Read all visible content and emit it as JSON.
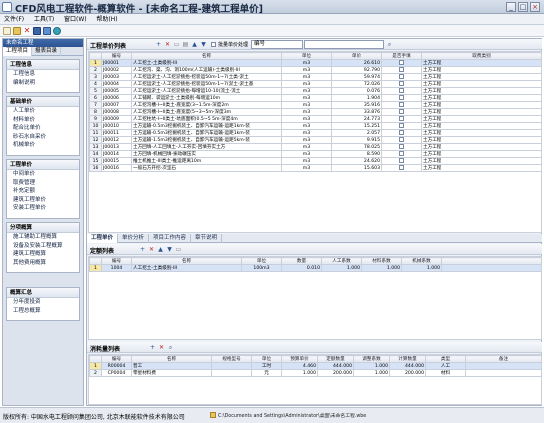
{
  "window": {
    "title": "CFD风电工程软件-概算软件 - [未命名工程-建筑工程单价]",
    "controls": [
      "_",
      "□",
      "×"
    ]
  },
  "menu": {
    "items": [
      "文件(F)",
      "工具(T)",
      "窗口(W)",
      "帮助(H)"
    ]
  },
  "left_panel": {
    "title": "未命名工程",
    "tabs": [
      "工程项目",
      "报表目录"
    ],
    "groups": [
      {
        "title": "工程信息",
        "items": [
          "工程信息",
          "编制说明"
        ]
      },
      {
        "title": "基础单价",
        "items": [
          "人工单价",
          "材料单价",
          "配合比单价",
          "砂石水自采价",
          "机械单价"
        ]
      },
      {
        "title": "工程单价",
        "items": [
          "中间单价",
          "取费管理",
          "补充定额",
          "建筑工程单价",
          "安装工程单价"
        ]
      },
      {
        "title": "分项概算",
        "items": [
          "施工辅助工程概算",
          "设备及安装工程概算",
          "建筑工程概算",
          "其他费用概算"
        ]
      },
      {
        "title": "概算汇总",
        "items": [
          "分年度投资",
          "工程总概算"
        ]
      }
    ]
  },
  "unit_price": {
    "title": "工程单价列表",
    "toolbar_check_label": "批量单价处理",
    "search_placeholder": "编号",
    "columns": [
      "",
      "编号",
      "名称",
      "单位",
      "单价",
      "是否手填",
      "取费类别"
    ],
    "rows": [
      [
        "1",
        "J00001",
        "人工挖土-土类级别-III",
        "m3",
        "26.610",
        "土方工程"
      ],
      [
        "2",
        "J00002",
        "人工挖沟、渠、沟、洞100m(人工运输)-土类级别-III",
        "m3",
        "92.790",
        "土方工程"
      ],
      [
        "3",
        "J00003",
        "人工挖运淤土-人工挖淤挑抬-挖装运50m-1~7(土类-淤土",
        "m3",
        "59.974",
        "土方工程"
      ],
      [
        "4",
        "J00004",
        "人工挖运淤土-人工挖淤挑抬-挖装运50m-1~7(淤土-淤土基",
        "m3",
        "72.026",
        "土方工程"
      ],
      [
        "5",
        "J00005",
        "人工挖运淤土-人工挖淤挑抬-每增运10-10(流土-流土",
        "m3",
        "0.076",
        "土方工程"
      ],
      [
        "6",
        "J00006",
        "人工铺砌、袋运淤土-土类级别-每增运10m",
        "m3",
        "1.904",
        "土方工程"
      ],
      [
        "7",
        "J00007",
        "人工挖沟槽-I~II类土-底宽度(3~1.5m-深度2m",
        "m3",
        "35.916",
        "土方工程"
      ],
      [
        "8",
        "J00008",
        "人工挖沟槽-I~II类土-底宽度(5~3~5m-深度3m",
        "m3",
        "33.876",
        "土方工程"
      ],
      [
        "9",
        "J00009",
        "人工挖柱坑-I~II类土-坑底面积(0.5~5 5m-深度4m",
        "m3",
        "24.773",
        "土方工程"
      ],
      [
        "10",
        "J00010",
        "土方运输-0.5m3挖掘机装土、自卸汽车运输-运距1km-装",
        "m3",
        "15.251",
        "土方工程"
      ],
      [
        "11",
        "J00011",
        "土方运输-0.5m3挖掘机装土、自卸汽车运输-运距1km-装",
        "m3",
        "2.057",
        "土方工程"
      ],
      [
        "12",
        "J00012",
        "土方运输-1.5m3挖掘机装土、自卸汽车运输-运距5km-装",
        "m3",
        "9.915",
        "土方工程"
      ],
      [
        "13",
        "J00013",
        "土方回填-人工回填土-人工夯实-回填夯实土方",
        "m3",
        "78.025",
        "土方工程"
      ],
      [
        "14",
        "J00014",
        "土方回填-机械回填-振动碾压实",
        "m3",
        "8.590",
        "土方工程"
      ],
      [
        "15",
        "J00015",
        "推土机推土-III类土-推运距离10m",
        "m3",
        "24.620",
        "土方工程"
      ],
      [
        "16",
        "J00016",
        "一般石方开挖-次坚石",
        "m3",
        "15.603",
        "土方工程"
      ]
    ]
  },
  "middle_tabs": [
    "工程单价",
    "单价分析",
    "项目工作内容",
    "章节说明"
  ],
  "quota": {
    "title": "定额列表",
    "columns": [
      "",
      "编号",
      "名称",
      "单位",
      "数量",
      "人工系数",
      "材料系数",
      "机械系数"
    ],
    "rows": [
      [
        "1",
        "1004",
        "人工挖土-土类级别-III",
        "100m3",
        "0.010",
        "1.000",
        "1.000",
        "1.000"
      ]
    ]
  },
  "consumption": {
    "title": "消耗量列表",
    "columns": [
      "",
      "编号",
      "名称",
      "规格型号",
      "单位",
      "预算单价",
      "定额数量",
      "调整系数",
      "计算数量",
      "类型",
      "备注"
    ],
    "rows": [
      [
        "1",
        "R00004",
        "普工",
        "",
        "工时",
        "4.460",
        "444.000",
        "1.000",
        "444.000",
        "人工",
        ""
      ],
      [
        "2",
        "CP0004",
        "零星材料费",
        "",
        "元",
        "1.000",
        "200.000",
        "1.000",
        "200.000",
        "材料",
        ""
      ]
    ]
  },
  "status": {
    "copyright": "版权所有: 中国水电工程顾问集团公司, 北京木联能软件技术有限公司",
    "path": "C:\\Documents and Settings\\Administrator\\桌面\\未命名工程.wbe"
  },
  "colors": {
    "accent": "#2d5393",
    "selected_row": "#d6e2f6",
    "selected_rownum": "#f6e7a7"
  }
}
